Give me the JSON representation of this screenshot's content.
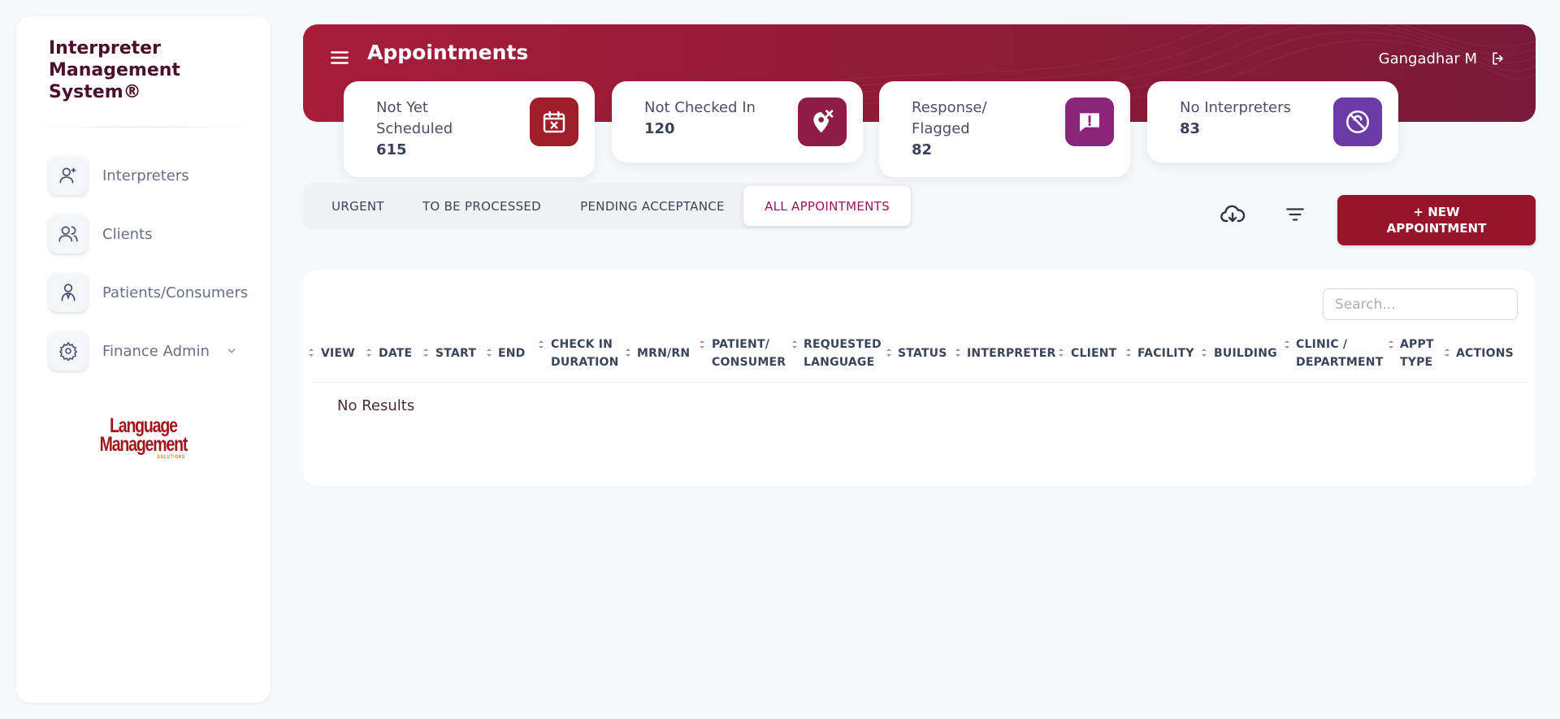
{
  "app": {
    "name": "Interpreter Management System®"
  },
  "sidebar": {
    "items": [
      {
        "label": "Interpreters",
        "icon": "user-add-icon"
      },
      {
        "label": "Clients",
        "icon": "users-icon"
      },
      {
        "label": "Patients/Consumers",
        "icon": "patient-icon"
      },
      {
        "label": "Finance Admin",
        "icon": "gear-icon"
      }
    ],
    "logo": {
      "line1": "Language",
      "line2": "Management",
      "line3": "SOLUTIONS"
    }
  },
  "header": {
    "title": "Appointments",
    "user": "Gangadhar M"
  },
  "stats": [
    {
      "label": "Not Yet Scheduled",
      "value": "615",
      "icon": "calendar-x-icon",
      "color": "#9e1f2a"
    },
    {
      "label": "Not Checked In",
      "value": "120",
      "icon": "location-x-icon",
      "color": "#8e1d45"
    },
    {
      "label": "Response/ Flagged",
      "value": "82",
      "icon": "flag-message-icon",
      "color": "#8a2579"
    },
    {
      "label": "No Interpreters",
      "value": "83",
      "icon": "no-interpreter-icon",
      "color": "#6b3aa5"
    }
  ],
  "tabs": [
    {
      "label": "URGENT"
    },
    {
      "label": "TO BE PROCESSED"
    },
    {
      "label": "PENDING ACCEPTANCE"
    },
    {
      "label": "ALL APPOINTMENTS",
      "active": true
    }
  ],
  "toolbar": {
    "new_appointment": "+ NEW APPOINTMENT"
  },
  "table": {
    "search_placeholder": "Search...",
    "columns": [
      {
        "line1": "VIEW",
        "line2": ""
      },
      {
        "line1": "DATE",
        "line2": ""
      },
      {
        "line1": "START",
        "line2": ""
      },
      {
        "line1": "END",
        "line2": ""
      },
      {
        "line1": "CHECK IN",
        "line2": "DURATION"
      },
      {
        "line1": "MRN/RN",
        "line2": ""
      },
      {
        "line1": "PATIENT/",
        "line2": "CONSUMER"
      },
      {
        "line1": "REQUESTED",
        "line2": "LANGUAGE"
      },
      {
        "line1": "STATUS",
        "line2": ""
      },
      {
        "line1": "INTERPRETER",
        "line2": ""
      },
      {
        "line1": "CLIENT",
        "line2": ""
      },
      {
        "line1": "FACILITY",
        "line2": ""
      },
      {
        "line1": "BUILDING",
        "line2": ""
      },
      {
        "line1": "CLINIC /",
        "line2": "DEPARTMENT"
      },
      {
        "line1": "APPT",
        "line2": "TYPE"
      },
      {
        "line1": "ACTIONS",
        "line2": ""
      }
    ],
    "empty_text": "No Results"
  }
}
